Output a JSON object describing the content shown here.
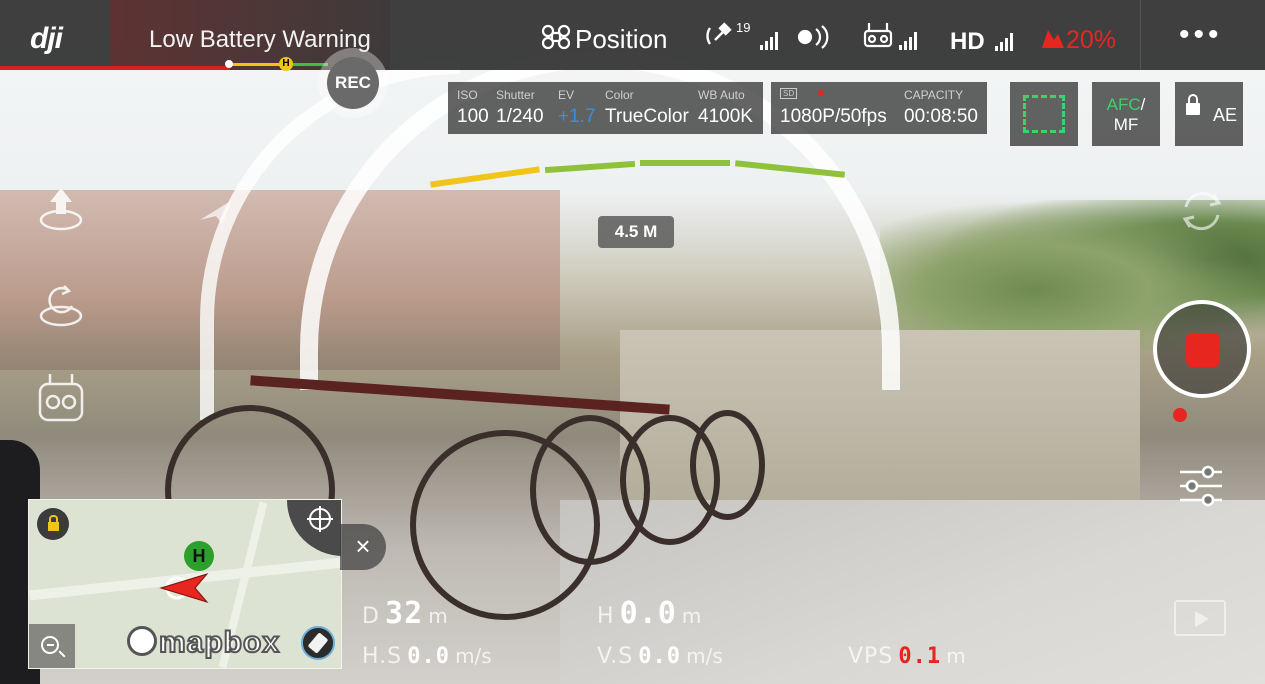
{
  "app": {
    "logo": "dji",
    "warning": "Low Battery Warning",
    "accent": "#e6261f",
    "battery_bar_marker": "H"
  },
  "status": {
    "flight_mode": "Position",
    "flight_mode_icon": "drone-icon",
    "gps_satellites": "19",
    "gps_icon": "satellite-icon",
    "vision_icon": "vision-sensor-icon",
    "rc_icon": "remote-controller-icon",
    "hd_label": "HD",
    "battery_percent": "20%",
    "battery_icon": "battery-icon",
    "more_label": "•••"
  },
  "record_button": "REC",
  "camera": {
    "iso_label": "ISO",
    "iso": "100",
    "shutter_label": "Shutter",
    "shutter": "1/240",
    "ev_label": "EV",
    "ev": "+1.7",
    "color_label": "Color",
    "color": "TrueColor",
    "wb_label": "WB Auto",
    "wb": "4100K",
    "ev_color": "#3a8fd8"
  },
  "storage": {
    "sd_label": "SD",
    "capacity_label": "CAPACITY",
    "resolution": "1080P/50fps",
    "capacity": "00:08:50"
  },
  "tiles": {
    "afc": "AFC",
    "afc_sep": "/",
    "mf": "MF",
    "ae": "AE",
    "focus_color": "#3cd26b"
  },
  "obstacle": {
    "distance": "4.5 M"
  },
  "map": {
    "brand": "mapbox",
    "home": "H",
    "close": "×"
  },
  "telemetry": {
    "d_label": "D",
    "d_value": "32",
    "d_unit": "m",
    "h_label": "H",
    "h_value": "0.0",
    "h_unit": "m",
    "hs_label": "H.S",
    "hs_value": "0.0",
    "hs_unit": "m/s",
    "vs_label": "V.S",
    "vs_value": "0.0",
    "vs_unit": "m/s",
    "vps_label": "VPS",
    "vps_value": "0.1",
    "vps_unit": "m"
  }
}
